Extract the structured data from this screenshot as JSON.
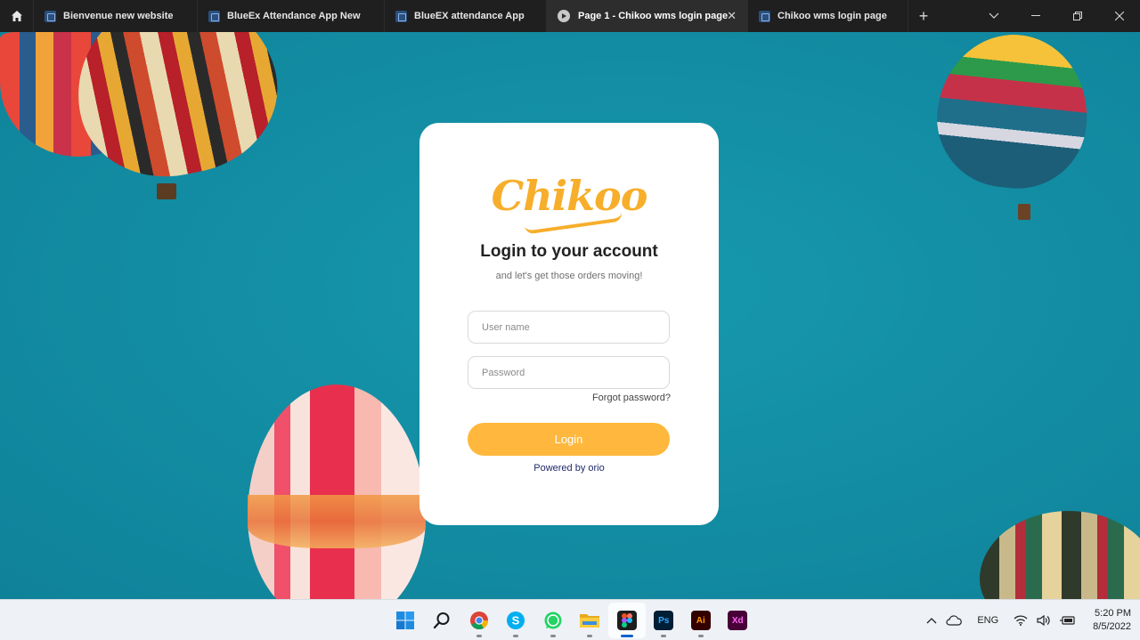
{
  "tabs": [
    {
      "title": "Bienvenue new website",
      "active": false
    },
    {
      "title": "BlueEx Attendance App New",
      "active": false
    },
    {
      "title": "BlueEX attendance App",
      "active": false
    },
    {
      "title": "Page 1 - Chikoo wms login page",
      "active": true
    },
    {
      "title": "Chikoo wms login page",
      "active": false
    }
  ],
  "login": {
    "logo_text": "Chikoo",
    "title": "Login to your account",
    "subtitle": "and let's get those orders moving!",
    "username_placeholder": "User name",
    "password_placeholder": "Password",
    "forgot_label": "Forgot password?",
    "login_label": "Login",
    "powered_by": "Powered by orio"
  },
  "taskbar": {
    "apps": [
      {
        "name": "start",
        "icon": "windows-icon",
        "running": false
      },
      {
        "name": "search",
        "icon": "search-icon",
        "running": false
      },
      {
        "name": "chrome",
        "icon": "chrome-icon",
        "running": true
      },
      {
        "name": "skype",
        "icon": "skype-icon",
        "running": true
      },
      {
        "name": "whatsapp",
        "icon": "whatsapp-icon",
        "running": true
      },
      {
        "name": "file-explorer",
        "icon": "folder-icon",
        "running": true
      },
      {
        "name": "figma",
        "icon": "figma-icon",
        "running": true,
        "active": true
      },
      {
        "name": "photoshop",
        "icon": "photoshop-icon",
        "label": "Ps",
        "running": true
      },
      {
        "name": "illustrator",
        "icon": "illustrator-icon",
        "label": "Ai",
        "running": true
      },
      {
        "name": "xd",
        "icon": "xd-icon",
        "label": "Xd",
        "running": false
      }
    ],
    "language": "ENG",
    "time": "5:20 PM",
    "date": "8/5/2022"
  },
  "colors": {
    "accent": "#ffb83d",
    "logo": "#f7ae2b",
    "background": "#138ea4",
    "powered_by": "#1f2a6b"
  }
}
